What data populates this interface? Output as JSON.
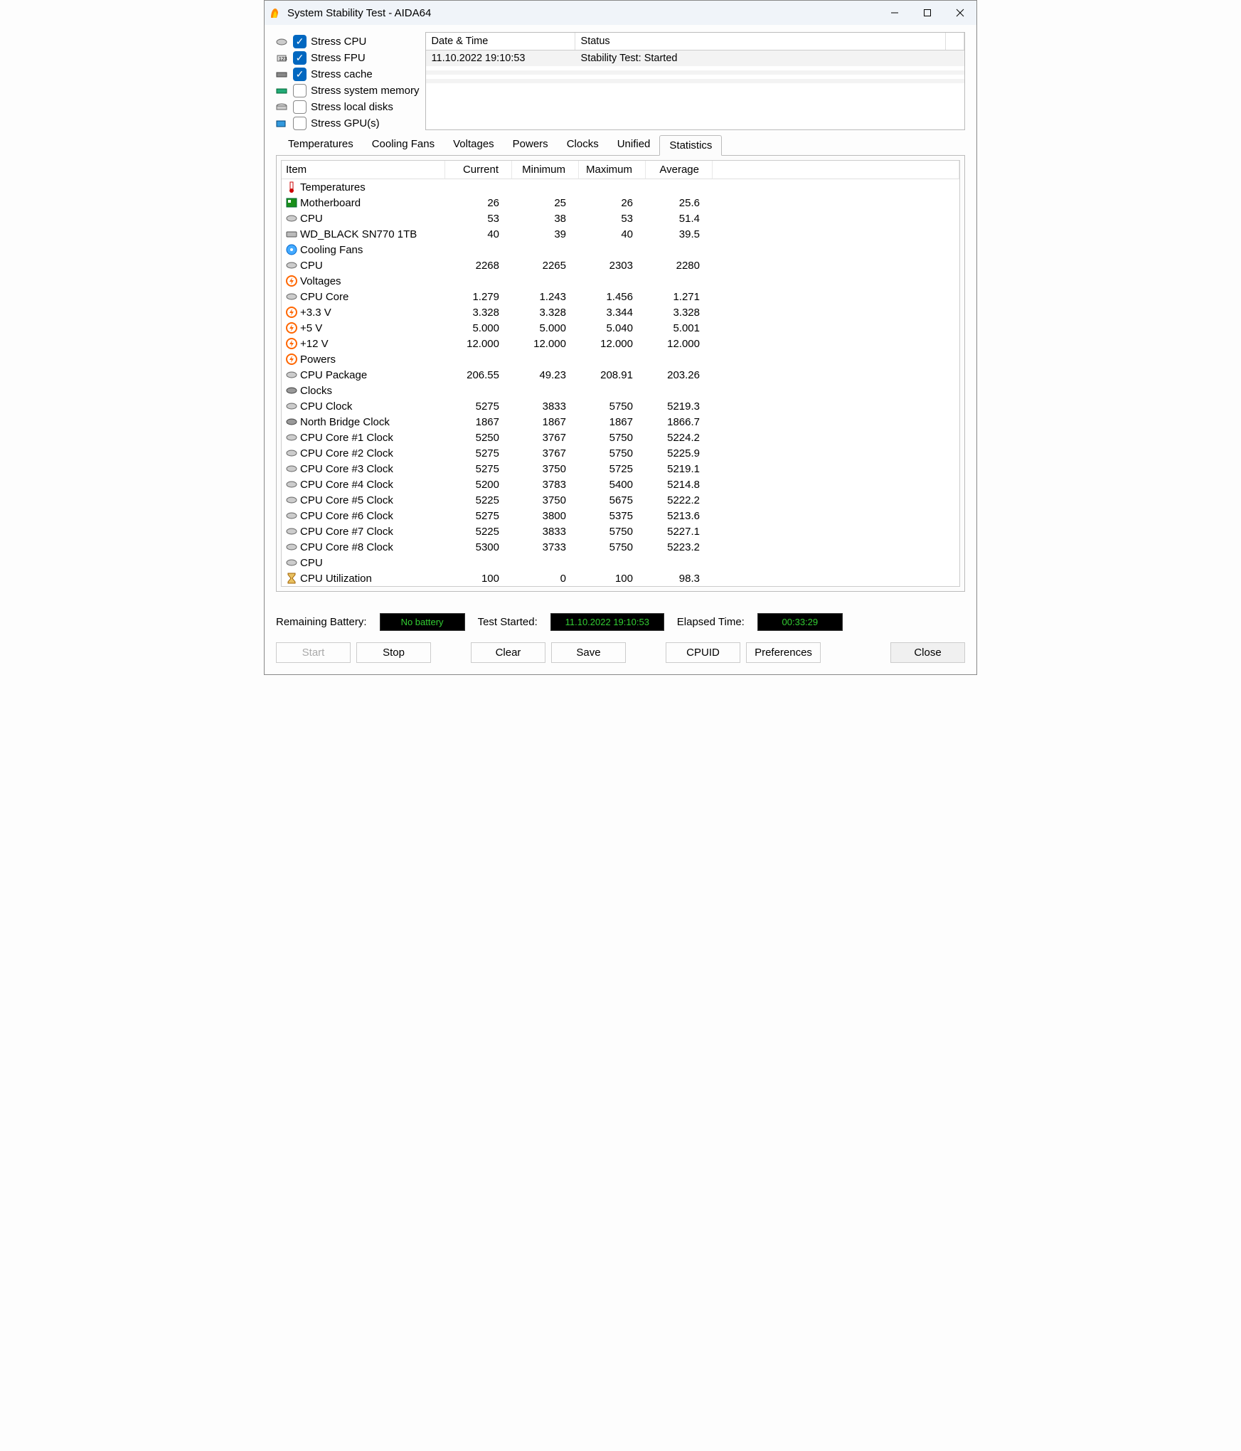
{
  "window": {
    "title": "System Stability Test - AIDA64"
  },
  "stress_options": [
    {
      "label": "Stress CPU",
      "checked": true,
      "icon": "chip"
    },
    {
      "label": "Stress FPU",
      "checked": true,
      "icon": "fpu"
    },
    {
      "label": "Stress cache",
      "checked": true,
      "icon": "ram"
    },
    {
      "label": "Stress system memory",
      "checked": false,
      "icon": "memory"
    },
    {
      "label": "Stress local disks",
      "checked": false,
      "icon": "disk"
    },
    {
      "label": "Stress GPU(s)",
      "checked": false,
      "icon": "gpu"
    }
  ],
  "log": {
    "headers": {
      "datetime": "Date & Time",
      "status": "Status"
    },
    "rows": [
      {
        "datetime": "11.10.2022 19:10:53",
        "status": "Stability Test: Started"
      }
    ]
  },
  "tabs": [
    "Temperatures",
    "Cooling Fans",
    "Voltages",
    "Powers",
    "Clocks",
    "Unified",
    "Statistics"
  ],
  "active_tab": "Statistics",
  "stats": {
    "headers": {
      "item": "Item",
      "current": "Current",
      "min": "Minimum",
      "max": "Maximum",
      "avg": "Average"
    },
    "sections": [
      {
        "title": "Temperatures",
        "icon": "therm",
        "rows": [
          {
            "icon": "mobo",
            "name": "Motherboard",
            "cur": "26",
            "min": "25",
            "max": "26",
            "avg": "25.6"
          },
          {
            "icon": "chip",
            "name": "CPU",
            "cur": "53",
            "min": "38",
            "max": "53",
            "avg": "51.4"
          },
          {
            "icon": "ssd",
            "name": "WD_BLACK SN770 1TB",
            "cur": "40",
            "min": "39",
            "max": "40",
            "avg": "39.5"
          }
        ]
      },
      {
        "title": "Cooling Fans",
        "icon": "fan",
        "rows": [
          {
            "icon": "chip",
            "name": "CPU",
            "cur": "2268",
            "min": "2265",
            "max": "2303",
            "avg": "2280"
          }
        ]
      },
      {
        "title": "Voltages",
        "icon": "volt",
        "rows": [
          {
            "icon": "chip",
            "name": "CPU Core",
            "cur": "1.279",
            "min": "1.243",
            "max": "1.456",
            "avg": "1.271"
          },
          {
            "icon": "volt",
            "name": "+3.3 V",
            "cur": "3.328",
            "min": "3.328",
            "max": "3.344",
            "avg": "3.328"
          },
          {
            "icon": "volt",
            "name": "+5 V",
            "cur": "5.000",
            "min": "5.000",
            "max": "5.040",
            "avg": "5.001"
          },
          {
            "icon": "volt",
            "name": "+12 V",
            "cur": "12.000",
            "min": "12.000",
            "max": "12.000",
            "avg": "12.000"
          }
        ]
      },
      {
        "title": "Powers",
        "icon": "volt",
        "rows": [
          {
            "icon": "chip",
            "name": "CPU Package",
            "cur": "206.55",
            "min": "49.23",
            "max": "208.91",
            "avg": "203.26"
          }
        ]
      },
      {
        "title": "Clocks",
        "icon": "clock",
        "rows": [
          {
            "icon": "chip",
            "name": "CPU Clock",
            "cur": "5275",
            "min": "3833",
            "max": "5750",
            "avg": "5219.3"
          },
          {
            "icon": "clock",
            "name": "North Bridge Clock",
            "cur": "1867",
            "min": "1867",
            "max": "1867",
            "avg": "1866.7"
          },
          {
            "icon": "chip",
            "name": "CPU Core #1 Clock",
            "cur": "5250",
            "min": "3767",
            "max": "5750",
            "avg": "5224.2"
          },
          {
            "icon": "chip",
            "name": "CPU Core #2 Clock",
            "cur": "5275",
            "min": "3767",
            "max": "5750",
            "avg": "5225.9"
          },
          {
            "icon": "chip",
            "name": "CPU Core #3 Clock",
            "cur": "5275",
            "min": "3750",
            "max": "5725",
            "avg": "5219.1"
          },
          {
            "icon": "chip",
            "name": "CPU Core #4 Clock",
            "cur": "5200",
            "min": "3783",
            "max": "5400",
            "avg": "5214.8"
          },
          {
            "icon": "chip",
            "name": "CPU Core #5 Clock",
            "cur": "5225",
            "min": "3750",
            "max": "5675",
            "avg": "5222.2"
          },
          {
            "icon": "chip",
            "name": "CPU Core #6 Clock",
            "cur": "5275",
            "min": "3800",
            "max": "5375",
            "avg": "5213.6"
          },
          {
            "icon": "chip",
            "name": "CPU Core #7 Clock",
            "cur": "5225",
            "min": "3833",
            "max": "5750",
            "avg": "5227.1"
          },
          {
            "icon": "chip",
            "name": "CPU Core #8 Clock",
            "cur": "5300",
            "min": "3733",
            "max": "5750",
            "avg": "5223.2"
          }
        ]
      },
      {
        "title": "CPU",
        "icon": "chip",
        "rows": [
          {
            "icon": "hourglass",
            "name": "CPU Utilization",
            "cur": "100",
            "min": "0",
            "max": "100",
            "avg": "98.3"
          }
        ]
      }
    ]
  },
  "status": {
    "battery_label": "Remaining Battery:",
    "battery_value": "No battery",
    "started_label": "Test Started:",
    "started_value": "11.10.2022 19:10:53",
    "elapsed_label": "Elapsed Time:",
    "elapsed_value": "00:33:29"
  },
  "buttons": {
    "start": "Start",
    "stop": "Stop",
    "clear": "Clear",
    "save": "Save",
    "cpuid": "CPUID",
    "preferences": "Preferences",
    "close": "Close"
  }
}
